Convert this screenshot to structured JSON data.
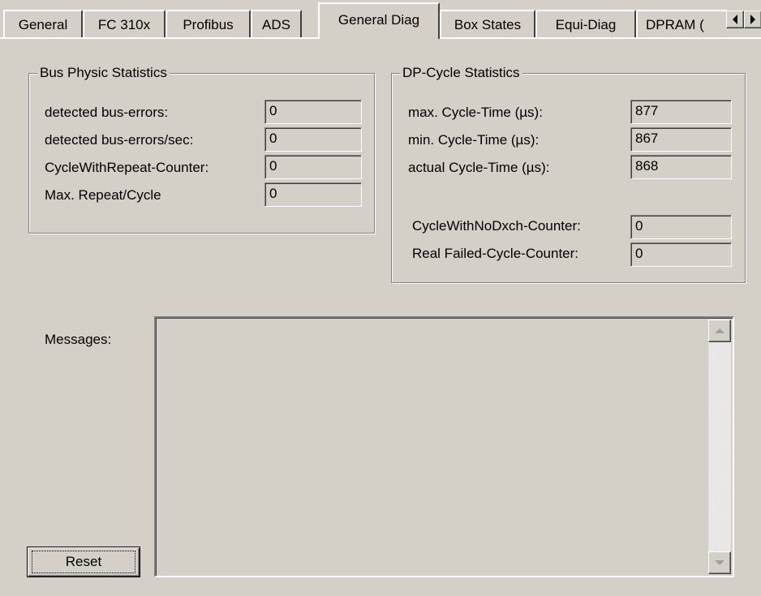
{
  "tabs": [
    {
      "label": "General"
    },
    {
      "label": "FC 310x"
    },
    {
      "label": "Profibus"
    },
    {
      "label": "ADS"
    },
    {
      "label": "General Diag"
    },
    {
      "label": "Box States"
    },
    {
      "label": "Equi-Diag"
    },
    {
      "label": "DPRAM ("
    }
  ],
  "active_tab": "General Diag",
  "bus_physic": {
    "title": "Bus Physic Statistics",
    "rows": [
      {
        "label": "detected bus-errors:",
        "value": "0"
      },
      {
        "label": "detected bus-errors/sec:",
        "value": "0"
      },
      {
        "label": "CycleWithRepeat-Counter:",
        "value": "0"
      },
      {
        "label": "Max. Repeat/Cycle",
        "value": "0"
      }
    ]
  },
  "dp_cycle": {
    "title": "DP-Cycle Statistics",
    "rows": [
      {
        "label": "max. Cycle-Time (µs):",
        "value": "877"
      },
      {
        "label": "min. Cycle-Time (µs):",
        "value": "867"
      },
      {
        "label": "actual Cycle-Time (µs):",
        "value": "868"
      },
      {
        "label": "CycleWithNoDxch-Counter:",
        "value": "0"
      },
      {
        "label": "Real Failed-Cycle-Counter:",
        "value": "0"
      }
    ]
  },
  "messages": {
    "label": "Messages:",
    "content": ""
  },
  "reset_label": "Reset",
  "icons": {
    "tab_scroll_left": "triangle-left-icon",
    "tab_scroll_right": "triangle-right-icon",
    "scroll_up": "arrow-up-icon",
    "scroll_down": "arrow-down-icon"
  }
}
